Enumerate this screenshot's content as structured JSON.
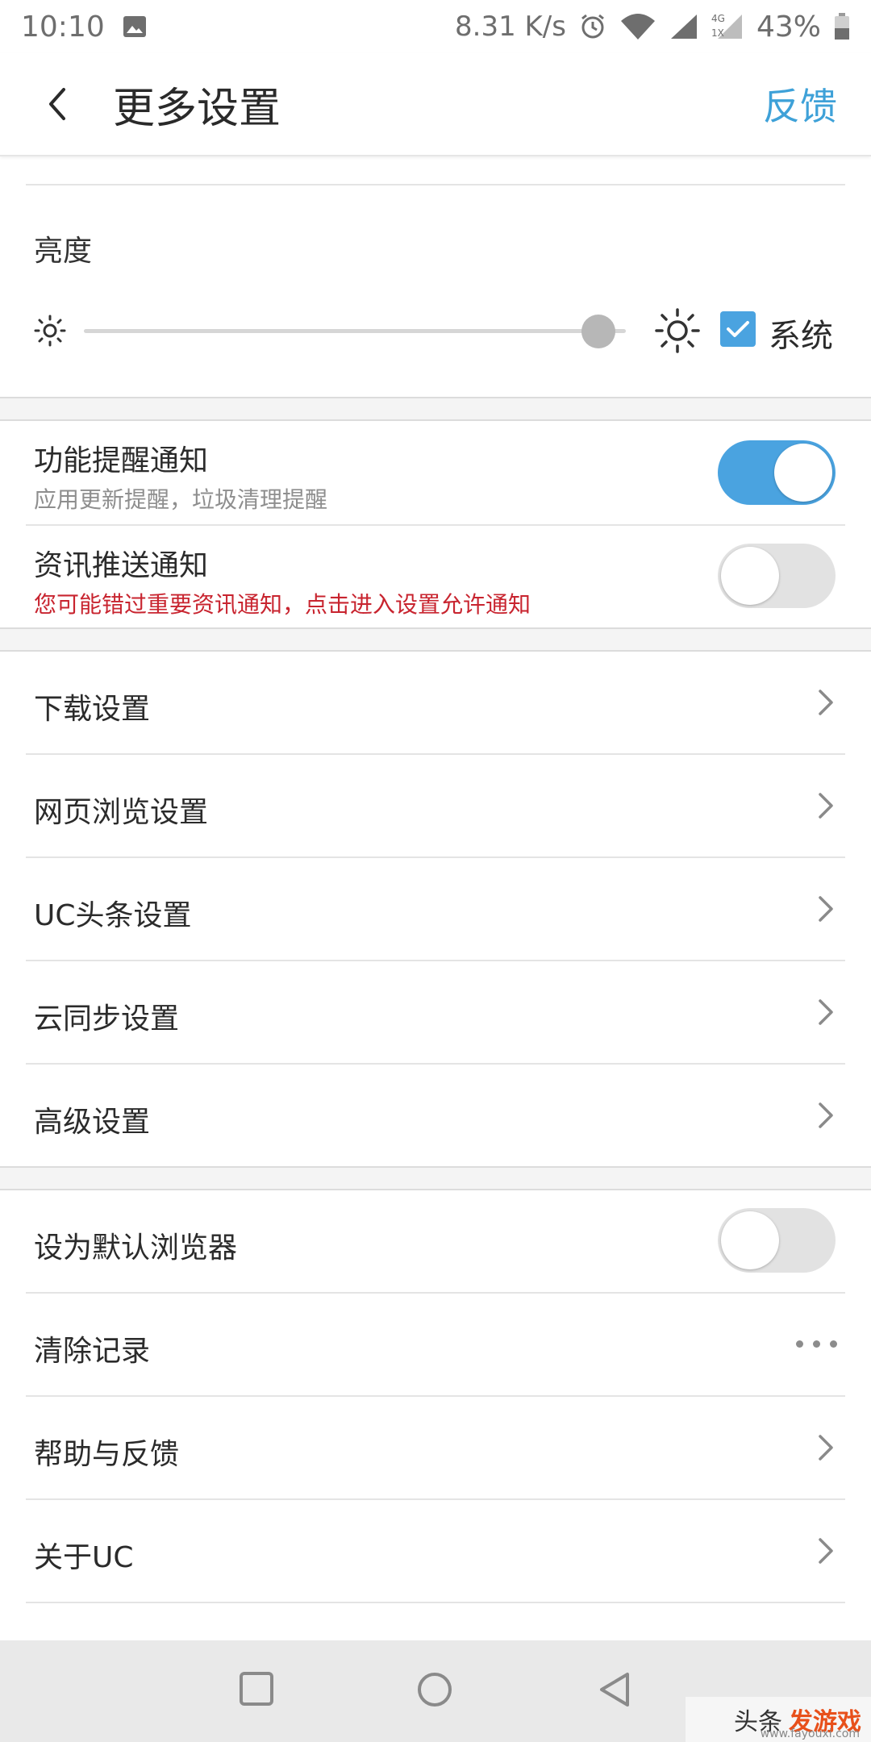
{
  "status_bar": {
    "time": "10:10",
    "net_speed": "8.31 K/s",
    "signal_top": "4G",
    "signal_bottom": "1X",
    "battery": "43%"
  },
  "header": {
    "title": "更多设置",
    "feedback_label": "反馈"
  },
  "brightness": {
    "title": "亮度",
    "level": 0.98,
    "system_label": "系统",
    "system_checked": true
  },
  "notifications": {
    "feature": {
      "title": "功能提醒通知",
      "subtitle": "应用更新提醒，垃圾清理提醒",
      "enabled": true
    },
    "news": {
      "title": "资讯推送通知",
      "subtitle": "您可能错过重要资讯通知，点击进入设置允许通知",
      "enabled": false
    }
  },
  "settings_list": [
    {
      "label": "下载设置"
    },
    {
      "label": "网页浏览设置"
    },
    {
      "label": "UC头条设置"
    },
    {
      "label": "云同步设置"
    },
    {
      "label": "高级设置"
    }
  ],
  "misc_list": {
    "default_browser": {
      "label": "设为默认浏览器",
      "enabled": false
    },
    "clear_records": {
      "label": "清除记录"
    },
    "help_feedback": {
      "label": "帮助与反馈"
    },
    "about": {
      "label": "关于UC"
    }
  },
  "colors": {
    "accent": "#4aa3e0",
    "warning": "#c8242f",
    "link": "#3ea1d8"
  },
  "watermark": {
    "prefix": "头条",
    "brand": "发游戏",
    "site": "www.fayouxi.com"
  }
}
